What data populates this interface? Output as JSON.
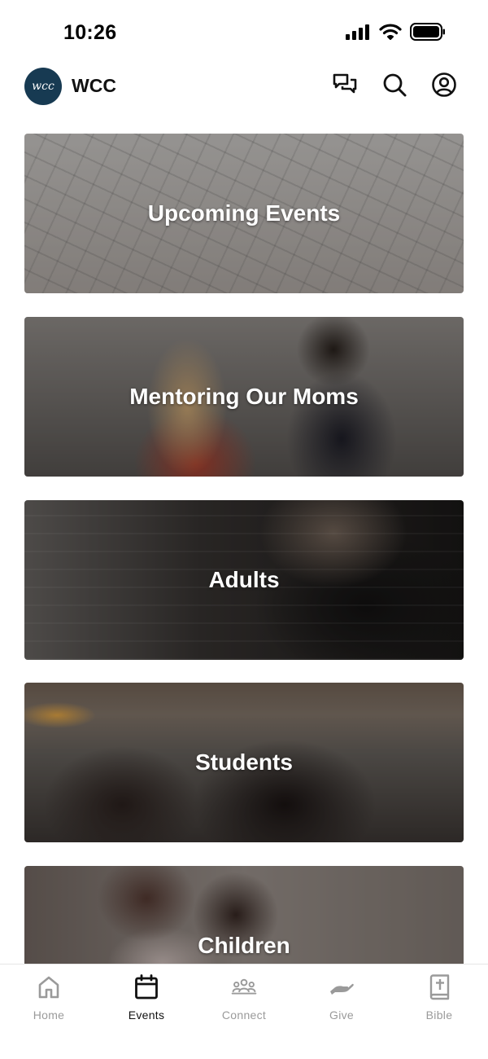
{
  "status_bar": {
    "time": "10:26",
    "icons": [
      "cellular-signal-icon",
      "wifi-icon",
      "battery-icon"
    ]
  },
  "header": {
    "logo_text": "wcc",
    "app_name": "WCC",
    "actions": [
      "messages-icon",
      "search-icon",
      "profile-icon"
    ]
  },
  "cards": [
    {
      "label": "Upcoming Events"
    },
    {
      "label": "Mentoring Our Moms"
    },
    {
      "label": "Adults"
    },
    {
      "label": "Students"
    },
    {
      "label": "Children"
    }
  ],
  "tabs": [
    {
      "label": "Home",
      "icon": "home-icon",
      "active": false
    },
    {
      "label": "Events",
      "icon": "calendar-icon",
      "active": true
    },
    {
      "label": "Connect",
      "icon": "group-icon",
      "active": false
    },
    {
      "label": "Give",
      "icon": "give-hand-icon",
      "active": false
    },
    {
      "label": "Bible",
      "icon": "bible-icon",
      "active": false
    }
  ],
  "colors": {
    "logo_bg": "#173a52",
    "tab_active": "#111111",
    "tab_inactive": "#9a9a9a"
  }
}
